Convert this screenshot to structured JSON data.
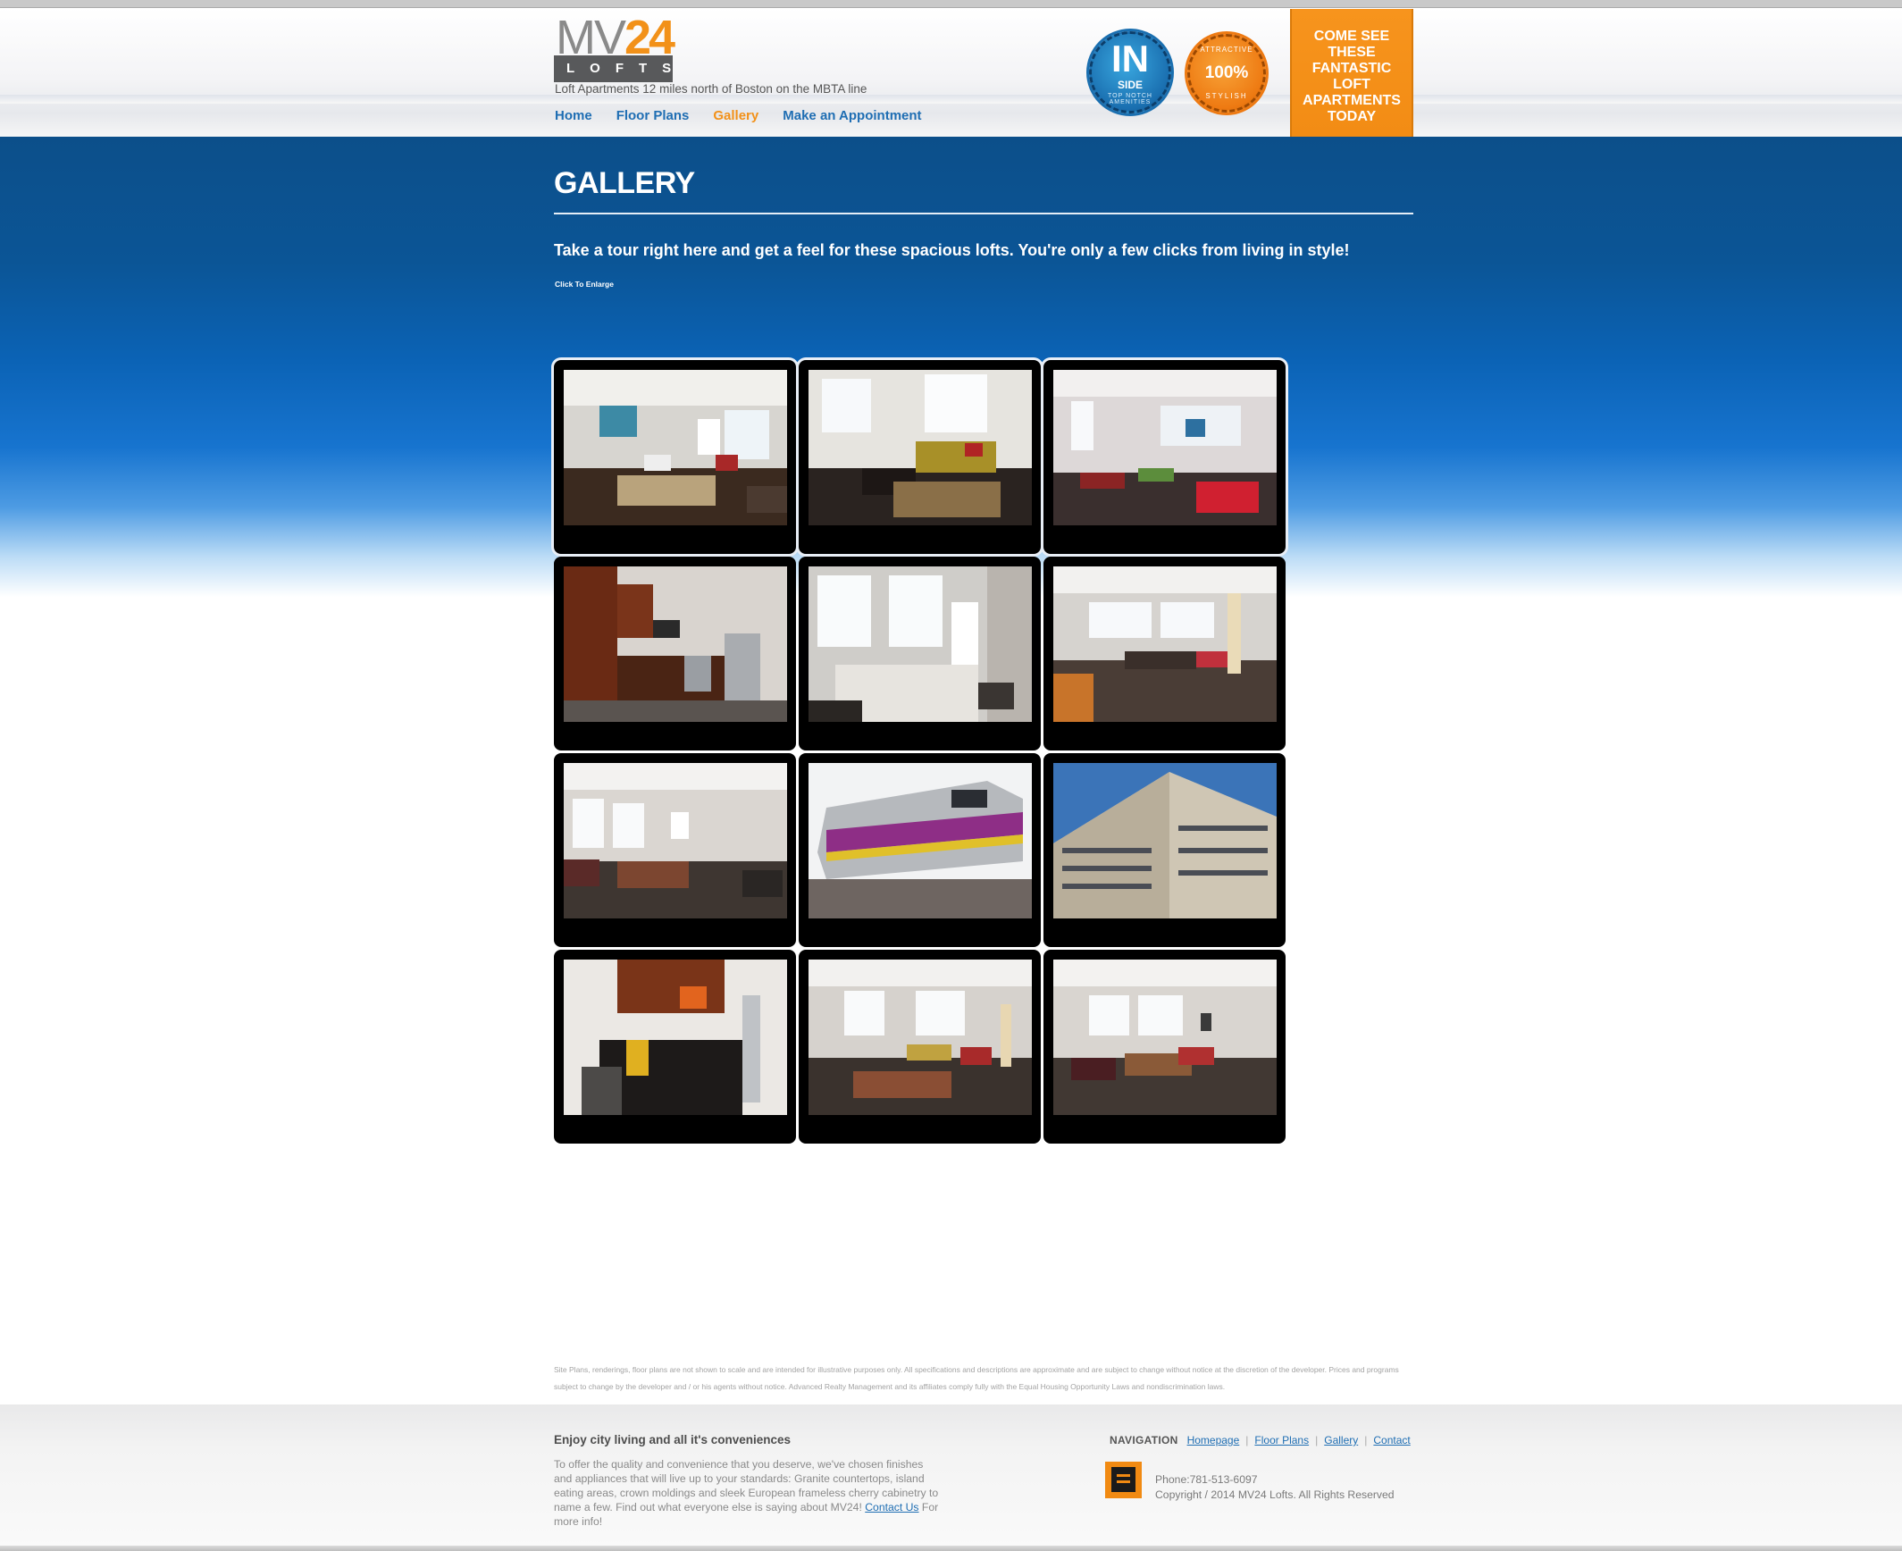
{
  "brand": {
    "logo_mv": "MV",
    "logo_num": "24",
    "logo_sub": "LOFTS",
    "tagline": "Loft Apartments 12 miles north of Boston on the MBTA line"
  },
  "nav": [
    {
      "label": "Home",
      "active": false
    },
    {
      "label": "Floor Plans",
      "active": false
    },
    {
      "label": "Gallery",
      "active": true
    },
    {
      "label": "Make an Appointment",
      "active": false
    }
  ],
  "badges": {
    "inside_big": "IN",
    "inside_small": "SIDE",
    "inside_ring": "TOP NOTCH AMENITIES",
    "stylish_big": "100%",
    "stylish_top": "ATTRACTIVE",
    "stylish_bottom": "STYLISH"
  },
  "ribbon": {
    "line1": "COME SEE",
    "line2": "THESE",
    "line3": "FANTASTIC LOFT",
    "line4": "APARTMENTS",
    "line5": "TODAY"
  },
  "page": {
    "title": "GALLERY",
    "intro": "Take a tour right here and get a feel for these spacious lofts. You're only a few clicks from living in style!",
    "enlarge_hint": "Click To Enlarge"
  },
  "gallery": [
    {
      "name": "living-room-dining-photo"
    },
    {
      "name": "living-room-yellow-sofa-photo"
    },
    {
      "name": "living-room-red-chairs-photo"
    },
    {
      "name": "kitchen-cherry-cabinets-photo"
    },
    {
      "name": "bedroom-sunlight-photo"
    },
    {
      "name": "open-living-area-photo"
    },
    {
      "name": "living-room-windows-photo"
    },
    {
      "name": "mbta-commuter-train-photo"
    },
    {
      "name": "loft-building-exterior-photo"
    },
    {
      "name": "kitchen-island-photo"
    },
    {
      "name": "living-room-rug-photo"
    },
    {
      "name": "living-room-wide-photo"
    }
  ],
  "disclaimer": "Site Plans, renderings, floor plans are not shown to scale and are intended for illustrative purposes only. All specifications and descriptions are approximate and are subject to change without notice at the discretion of the developer. Prices and programs subject to change by the developer and / or his agents without notice. Advanced Realty Management and its affiliates comply fully with the Equal Housing Opportunity Laws and nondiscrimination laws.",
  "footer": {
    "title": "Enjoy city living and all it's conveniences",
    "text": "To offer the quality and convenience that you deserve, we've chosen finishes and appliances that will live up to your standards: Granite countertops, island eating areas, crown moldings and sleek European frameless cherry cabinetry to name a few. Find out what everyone else is saying about MV24!",
    "contact_link": "Contact Us",
    "text_after": "For more info!",
    "nav_label": "NAVIGATION",
    "nav_links": [
      "Homepage",
      "Floor Plans",
      "Gallery",
      "Contact"
    ],
    "phone": "Phone:781-513-6097",
    "copyright": "Copyright / 2014 MV24 Lofts. All Rights Reserved"
  },
  "colors": {
    "brand_orange": "#f29119",
    "link_blue": "#1f6eb3",
    "hero_blue": "#0b5596"
  }
}
